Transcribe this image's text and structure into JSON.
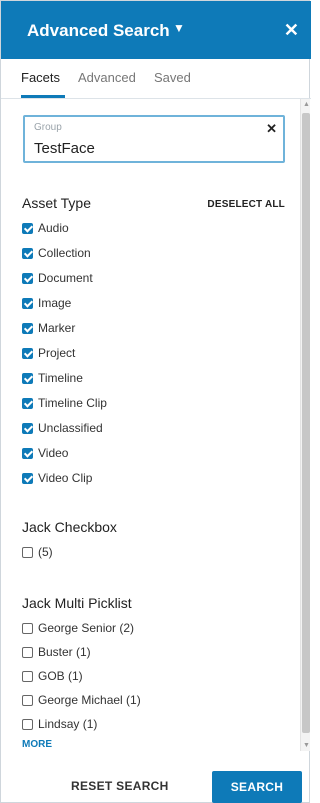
{
  "header": {
    "title": "Advanced Search",
    "caret_icon": "caret-down-icon",
    "close_icon": "close-icon"
  },
  "tabs": [
    {
      "label": "Facets",
      "active": true
    },
    {
      "label": "Advanced",
      "active": false
    },
    {
      "label": "Saved",
      "active": false
    }
  ],
  "group_field": {
    "label": "Group",
    "value": "TestFace",
    "clear_icon": "clear-icon"
  },
  "asset_type": {
    "title": "Asset Type",
    "deselect_all": "DESELECT ALL",
    "options": [
      {
        "label": "Audio",
        "checked": true
      },
      {
        "label": "Collection",
        "checked": true
      },
      {
        "label": "Document",
        "checked": true
      },
      {
        "label": "Image",
        "checked": true
      },
      {
        "label": "Marker",
        "checked": true
      },
      {
        "label": "Project",
        "checked": true
      },
      {
        "label": "Timeline",
        "checked": true
      },
      {
        "label": "Timeline Clip",
        "checked": true
      },
      {
        "label": "Unclassified",
        "checked": true
      },
      {
        "label": "Video",
        "checked": true
      },
      {
        "label": "Video Clip",
        "checked": true
      }
    ]
  },
  "jack_checkbox": {
    "title": "Jack Checkbox",
    "options": [
      {
        "label": "(5)",
        "checked": false
      }
    ]
  },
  "jack_multi_picklist": {
    "title": "Jack Multi Picklist",
    "options": [
      {
        "label": "George Senior (2)",
        "checked": false
      },
      {
        "label": "Buster (1)",
        "checked": false
      },
      {
        "label": "GOB (1)",
        "checked": false
      },
      {
        "label": "George Michael (1)",
        "checked": false
      },
      {
        "label": "Lindsay (1)",
        "checked": false
      }
    ],
    "more": "MORE"
  },
  "footer": {
    "reset": "RESET SEARCH",
    "search": "SEARCH"
  },
  "colors": {
    "accent": "#0e7ab8",
    "field_border": "#6fb3da"
  }
}
